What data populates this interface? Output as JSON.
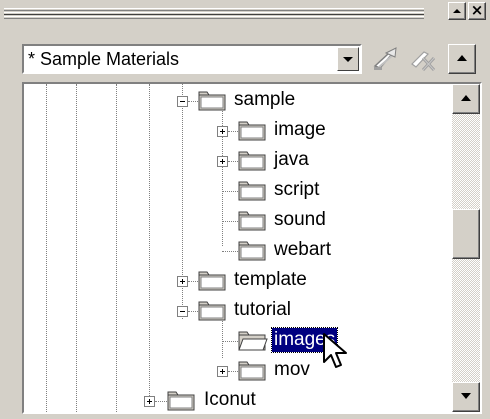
{
  "title_bar": {
    "close_glyph": "×",
    "up_icon": "triangle-up-icon"
  },
  "toolbar": {
    "library_select": {
      "value": "* Sample Materials",
      "icon": "chevron-down-icon"
    },
    "edit_icon": "pencil-edit-icon",
    "delete_icon": "delete-x-icon",
    "up_button_icon": "triangle-up-icon"
  },
  "tree": {
    "items": [
      {
        "label": "sample",
        "depth": 0,
        "expander": "minus"
      },
      {
        "label": "image",
        "depth": 1,
        "expander": "plus"
      },
      {
        "label": "java",
        "depth": 1,
        "expander": "plus"
      },
      {
        "label": "script",
        "depth": 1,
        "expander": "none"
      },
      {
        "label": "sound",
        "depth": 1,
        "expander": "none"
      },
      {
        "label": "webart",
        "depth": 1,
        "expander": "none"
      },
      {
        "label": "template",
        "depth": 0,
        "expander": "plus"
      },
      {
        "label": "tutorial",
        "depth": 0,
        "expander": "minus"
      },
      {
        "label": "images",
        "depth": 1,
        "expander": "none",
        "selected": true
      },
      {
        "label": "mov",
        "depth": 1,
        "expander": "plus"
      },
      {
        "label": "Iconut",
        "depth": -1,
        "expander": "plus"
      }
    ],
    "folder_icon": "folder-icon",
    "open_folder_icon": "folder-open-icon"
  },
  "scrollbar": {
    "position": 0.5
  },
  "colors": {
    "selection": "#000080",
    "face": "#d4d0c8"
  }
}
